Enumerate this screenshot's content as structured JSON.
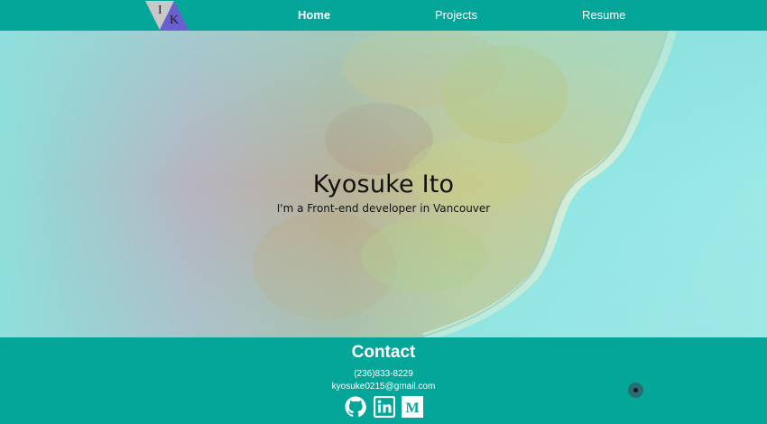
{
  "nav": {
    "logo": {
      "letters": [
        "I",
        "K"
      ],
      "colors": {
        "top": "#c8c8c8",
        "bottom": "#6a5fd0"
      }
    },
    "links": [
      {
        "label": "Home",
        "active": true
      },
      {
        "label": "Projects",
        "active": false
      },
      {
        "label": "Resume",
        "active": false
      }
    ]
  },
  "hero": {
    "name": "Kyosuke Ito",
    "tagline": "I'm a Front-end developer in Vancouver",
    "background_image": "aerial coastline photo with teal overlay"
  },
  "contact": {
    "title": "Contact",
    "phone": "(236)833-8229",
    "email": "kyosuke0215@gmail.com",
    "social_icons": [
      "github-icon",
      "linkedin-icon",
      "medium-icon"
    ]
  },
  "colors": {
    "brand_teal": "#04a69a",
    "text_light": "#ffffff",
    "text_dark": "#111111"
  }
}
